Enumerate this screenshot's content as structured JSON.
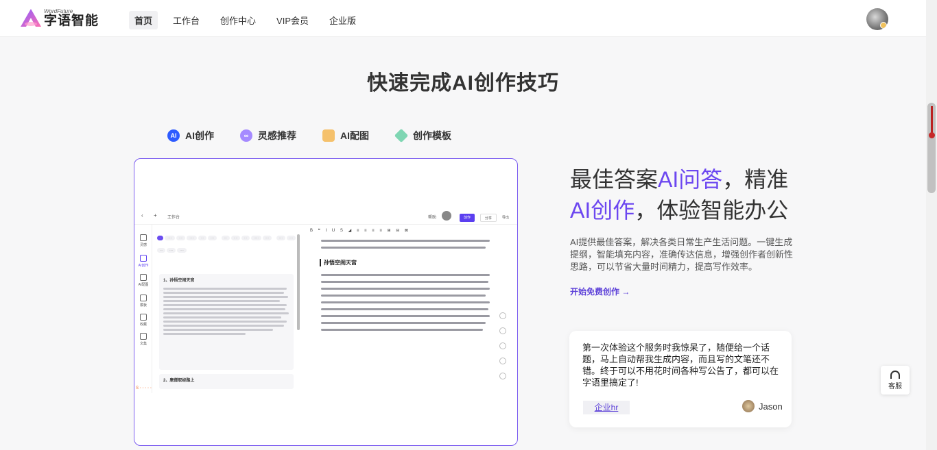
{
  "header": {
    "logo_en": "WordFuture",
    "logo_cn": "字语智能",
    "nav": [
      "首页",
      "工作台",
      "创作中心",
      "VIP会员",
      "企业版"
    ],
    "active_nav": 0
  },
  "section": {
    "title": "快速完成AI创作技巧"
  },
  "tabs": [
    {
      "label": "AI创作",
      "icon": "ai-icon"
    },
    {
      "label": "灵感推荐",
      "icon": "inspiration-icon"
    },
    {
      "label": "AI配图",
      "icon": "image-icon"
    },
    {
      "label": "创作模板",
      "icon": "template-icon"
    }
  ],
  "preview": {
    "topbar": {
      "workbench": "工作台",
      "ai_button": "创作",
      "share": "分享",
      "export": "导出",
      "help": "帮助"
    },
    "sidebar": [
      "灵感",
      "AI创作",
      "AI配图",
      "模板",
      "收藏",
      "文集"
    ],
    "mid_heading_1": "1、孙悟空闹天宫",
    "mid_heading_2": "2、唐僧取经路上",
    "doc_title": "孙悟空闹天宫"
  },
  "copy": {
    "headline_part1": "最佳答案",
    "headline_accent1": "AI问答",
    "headline_part2": "，精准",
    "headline_accent2": "AI创作",
    "headline_part3": "，体验智能办公",
    "description": "AI提供最佳答案，解决各类日常生产生活问题。一键生成提纲，智能填充内容，准确传达信息，增强创作者创新性思路，可以节省大量时间精力，提高写作效率。",
    "cta": "开始免费创作  →"
  },
  "review": {
    "text": "第一次体验这个服务时我惊呆了，随便给一个话题，马上自动帮我生成内容，而且写的文笔还不错。终于可以不用花时间各种写公告了，都可以在字语里搞定了!",
    "tag": "企业hr",
    "user": "Jason"
  },
  "service": {
    "label": "客服"
  }
}
